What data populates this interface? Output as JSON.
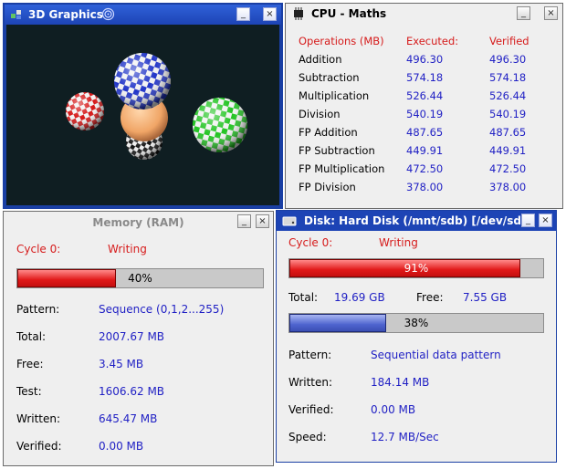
{
  "graphics": {
    "title": "3D Graphics"
  },
  "cpu": {
    "title": "CPU - Maths",
    "headers": [
      "Operations (MB)",
      "Executed:",
      "Verified"
    ],
    "rows": [
      [
        "Addition",
        "496.30",
        "496.30"
      ],
      [
        "Subtraction",
        "574.18",
        "574.18"
      ],
      [
        "Multiplication",
        "526.44",
        "526.44"
      ],
      [
        "Division",
        "540.19",
        "540.19"
      ],
      [
        "FP Addition",
        "487.65",
        "487.65"
      ],
      [
        "FP Subtraction",
        "449.91",
        "449.91"
      ],
      [
        "FP Multiplication",
        "472.50",
        "472.50"
      ],
      [
        "FP Division",
        "378.00",
        "378.00"
      ]
    ]
  },
  "memory": {
    "title": "Memory (RAM)",
    "cycle_label": "Cycle 0:",
    "cycle_status": "Writing",
    "progress": 0.4,
    "progress_text": "40%",
    "pattern_label": "Pattern:",
    "pattern_value": "Sequence (0,1,2...255)",
    "total_label": "Total:",
    "total_value": "2007.67 MB",
    "free_label": "Free:",
    "free_value": "3.45 MB",
    "test_label": "Test:",
    "test_value": "1606.62 MB",
    "written_label": "Written:",
    "written_value": "645.47 MB",
    "verified_label": "Verified:",
    "verified_value": "0.00 MB"
  },
  "disk": {
    "title": "Disk: Hard Disk (/mnt/sdb) [/dev/sdb",
    "cycle_label": "Cycle 0:",
    "cycle_status": "Writing",
    "progress": 0.91,
    "progress_text": "91%",
    "total_label": "Total:",
    "total_value": "19.69 GB",
    "free_label": "Free:",
    "free_value": "7.55 GB",
    "usage": 0.38,
    "usage_text": "38%",
    "pattern_label": "Pattern:",
    "pattern_value": "Sequential data pattern",
    "written_label": "Written:",
    "written_value": "184.14 MB",
    "verified_label": "Verified:",
    "verified_value": "0.00 MB",
    "speed_label": "Speed:",
    "speed_value": "12.7 MB/Sec"
  },
  "buttons": {
    "minimize": "_",
    "close": "×"
  },
  "colors": {
    "accent_red": "#d61b1b",
    "value_blue": "#1f1fc4",
    "titlebar_blue": "#1d44b5"
  }
}
